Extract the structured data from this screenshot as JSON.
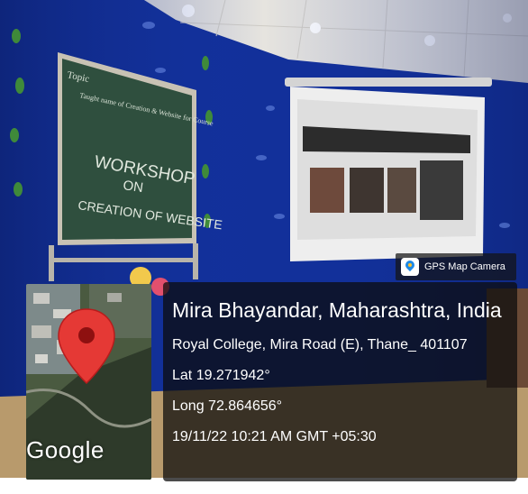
{
  "board_text": {
    "line1": "Topic",
    "line2": "Taught name of Creation & Website for Course",
    "line3": "WORKSHOP",
    "line4": "ON",
    "line5": "CREATION OF WEBSITE"
  },
  "geotag": {
    "app_name": "GPS Map Camera",
    "location_title": "Mira Bhayandar, Maharashtra, India",
    "address": "Royal College, Mira Road (E), Thane_ 401107",
    "latitude": "Lat 19.271942°",
    "longitude": "Long 72.864656°",
    "timestamp": "19/11/22 10:21 AM GMT +05:30"
  },
  "map": {
    "brand": "Google",
    "marker_icon": "location-pin-icon"
  },
  "colors": {
    "wall": "#12309a",
    "panel": "#0c0c0c",
    "pin": "#e53935"
  }
}
